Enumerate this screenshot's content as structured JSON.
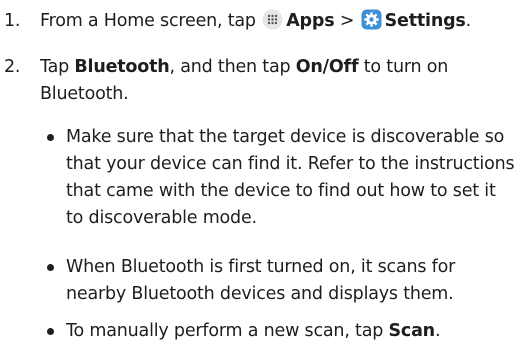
{
  "steps": [
    {
      "number": "1.",
      "part1": "From a Home screen, tap",
      "apps_label": "Apps",
      "separator": " > ",
      "settings_label": "Settings",
      "end": "."
    },
    {
      "number": "2.",
      "part1": "Tap ",
      "bluetooth_label": "Bluetooth",
      "part2": ", and then tap ",
      "onoff_label": "On/Off",
      "part3": " to turn on Bluetooth."
    }
  ],
  "bullets": [
    {
      "text": "Make sure that the target device is discoverable so that your device can find it. Refer to the instructions that came with the device to find out how to set it to discoverable mode."
    },
    {
      "text": "When Bluetooth is first turned on, it scans for nearby Bluetooth devices and displays them."
    },
    {
      "text_before": "To manually perform a new scan, tap ",
      "scan_label": "Scan",
      "text_after": "."
    }
  ],
  "icons": {
    "apps": "apps-grid-icon",
    "settings": "settings-gear-icon",
    "apps_color": "#e6e6e6",
    "settings_color": "#3d8fd6"
  }
}
